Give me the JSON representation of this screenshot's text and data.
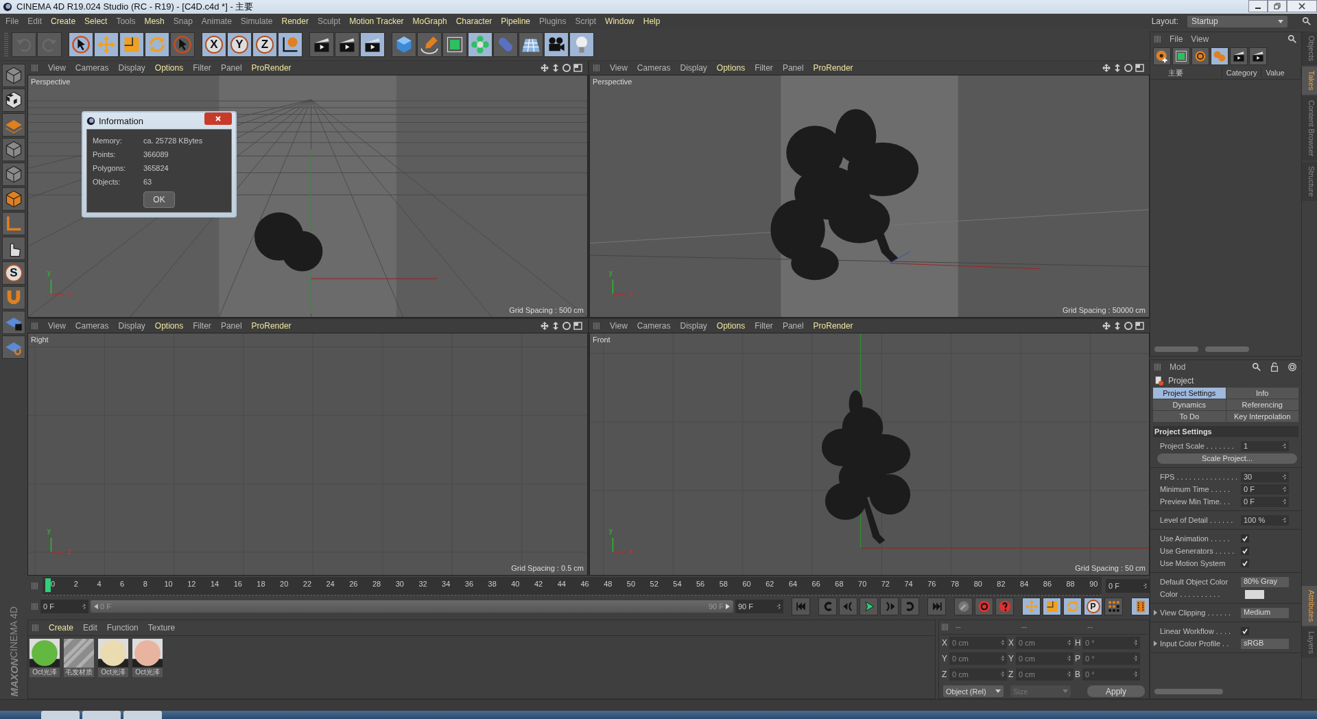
{
  "window": {
    "title": "CINEMA 4D R19.024 Studio (RC - R19) - [C4D.c4d *] - 主要"
  },
  "menu": [
    {
      "label": "File",
      "highlight": false
    },
    {
      "label": "Edit",
      "highlight": false
    },
    {
      "label": "Create",
      "highlight": true
    },
    {
      "label": "Select",
      "highlight": true
    },
    {
      "label": "Tools",
      "highlight": false
    },
    {
      "label": "Mesh",
      "highlight": true
    },
    {
      "label": "Snap",
      "highlight": false
    },
    {
      "label": "Animate",
      "highlight": false
    },
    {
      "label": "Simulate",
      "highlight": false
    },
    {
      "label": "Render",
      "highlight": true
    },
    {
      "label": "Sculpt",
      "highlight": false
    },
    {
      "label": "Motion Tracker",
      "highlight": true
    },
    {
      "label": "MoGraph",
      "highlight": true
    },
    {
      "label": "Character",
      "highlight": true
    },
    {
      "label": "Pipeline",
      "highlight": true
    },
    {
      "label": "Plugins",
      "highlight": false
    },
    {
      "label": "Script",
      "highlight": false
    },
    {
      "label": "Window",
      "highlight": true
    },
    {
      "label": "Help",
      "highlight": true
    }
  ],
  "layout": {
    "label": "Layout:",
    "value": "Startup"
  },
  "toolbar": [
    [
      {
        "kind": "undo",
        "active": false
      },
      {
        "kind": "redo",
        "active": false
      }
    ],
    [
      {
        "kind": "cursor",
        "active": true
      },
      {
        "kind": "move",
        "active": true
      },
      {
        "kind": "scale",
        "active": true
      },
      {
        "kind": "rotate",
        "active": true
      },
      {
        "kind": "cursor",
        "active": false
      }
    ],
    [
      {
        "kind": "letter",
        "label": "X",
        "active": true
      },
      {
        "kind": "letter",
        "label": "Y",
        "active": true
      },
      {
        "kind": "letter",
        "label": "Z",
        "active": true
      },
      {
        "kind": "world",
        "active": true
      }
    ],
    [
      {
        "kind": "clapper",
        "active": false
      },
      {
        "kind": "clapper",
        "active": false
      },
      {
        "kind": "clapper",
        "active": true
      }
    ],
    [
      {
        "kind": "cube",
        "active": false
      },
      {
        "kind": "pen",
        "active": false
      },
      {
        "kind": "cage",
        "active": false
      },
      {
        "kind": "flower",
        "active": true
      },
      {
        "kind": "capsule",
        "active": false
      },
      {
        "kind": "floor",
        "active": false
      },
      {
        "kind": "camera",
        "active": true
      },
      {
        "kind": "light",
        "active": true
      }
    ]
  ],
  "left_tools": [
    {
      "kind": "model",
      "active": false
    },
    {
      "kind": "checker",
      "active": false
    },
    {
      "kind": "plane",
      "active": false
    },
    {
      "kind": "model",
      "active": false
    },
    {
      "kind": "model",
      "active": false
    },
    {
      "kind": "face",
      "active": false
    },
    {
      "kind": "axis",
      "active": false
    },
    {
      "kind": "hand",
      "active": false
    },
    {
      "kind": "letter",
      "label": "S",
      "active": false
    },
    {
      "kind": "magnet",
      "active": false
    },
    {
      "kind": "lockgrid",
      "active": false
    },
    {
      "kind": "grid",
      "active": false
    }
  ],
  "viewports": [
    {
      "kind": "perspective-near",
      "name": "Perspective",
      "grid_spacing": "Grid Spacing : 500 cm",
      "axis_labels": [
        "y",
        "x"
      ],
      "menu": [
        {
          "label": "View",
          "highlight": false
        },
        {
          "label": "Cameras",
          "highlight": false
        },
        {
          "label": "Display",
          "highlight": false
        },
        {
          "label": "Options",
          "highlight": true
        },
        {
          "label": "Filter",
          "highlight": false
        },
        {
          "label": "Panel",
          "highlight": false
        },
        {
          "label": "ProRender",
          "highlight": true
        }
      ]
    },
    {
      "kind": "perspective-far",
      "name": "Perspective",
      "grid_spacing": "Grid Spacing : 50000 cm",
      "axis_labels": [
        "y",
        "x"
      ],
      "menu": [
        {
          "label": "View",
          "highlight": false
        },
        {
          "label": "Cameras",
          "highlight": false
        },
        {
          "label": "Display",
          "highlight": false
        },
        {
          "label": "Options",
          "highlight": true
        },
        {
          "label": "Filter",
          "highlight": false
        },
        {
          "label": "Panel",
          "highlight": false
        },
        {
          "label": "ProRender",
          "highlight": true
        }
      ]
    },
    {
      "kind": "side",
      "name": "Right",
      "grid_spacing": "Grid Spacing : 0.5 cm",
      "axis_labels": [
        "y",
        "z"
      ],
      "menu": [
        {
          "label": "View",
          "highlight": false
        },
        {
          "label": "Cameras",
          "highlight": false
        },
        {
          "label": "Display",
          "highlight": false
        },
        {
          "label": "Options",
          "highlight": true
        },
        {
          "label": "Filter",
          "highlight": false
        },
        {
          "label": "Panel",
          "highlight": false
        },
        {
          "label": "ProRender",
          "highlight": true
        }
      ]
    },
    {
      "kind": "front",
      "name": "Front",
      "grid_spacing": "Grid Spacing : 50 cm",
      "axis_labels": [
        "y",
        "x"
      ],
      "menu": [
        {
          "label": "View",
          "highlight": false
        },
        {
          "label": "Cameras",
          "highlight": false
        },
        {
          "label": "Display",
          "highlight": false
        },
        {
          "label": "Options",
          "highlight": true
        },
        {
          "label": "Filter",
          "highlight": false
        },
        {
          "label": "Panel",
          "highlight": false
        },
        {
          "label": "ProRender",
          "highlight": true
        }
      ]
    }
  ],
  "dialog": {
    "title": "Information",
    "rows": [
      {
        "label": "Memory:",
        "value": "ca. 25728 KBytes"
      },
      {
        "label": "Points:",
        "value": "366089"
      },
      {
        "label": "Polygons:",
        "value": "365824"
      },
      {
        "label": "Objects:",
        "value": "63"
      }
    ],
    "button": "OK"
  },
  "timeline": {
    "ticks": [
      "0",
      "2",
      "4",
      "6",
      "8",
      "10",
      "12",
      "14",
      "16",
      "18",
      "20",
      "22",
      "24",
      "26",
      "28",
      "30",
      "32",
      "34",
      "36",
      "38",
      "40",
      "42",
      "44",
      "46",
      "48",
      "50",
      "52",
      "54",
      "56",
      "58",
      "60",
      "62",
      "64",
      "66",
      "68",
      "70",
      "72",
      "74",
      "76",
      "78",
      "80",
      "82",
      "84",
      "86",
      "88",
      "90"
    ],
    "level": 0,
    "current": "0 F"
  },
  "range": {
    "start": "0 F",
    "slider_start": "0 F",
    "slider_end": "90 F",
    "end": "90 F"
  },
  "playback": [
    [
      {
        "kind": "first",
        "active": false
      }
    ],
    [
      {
        "kind": "prevkey",
        "active": false
      },
      {
        "kind": "prevframe",
        "active": false
      },
      {
        "kind": "play",
        "active": false
      },
      {
        "kind": "nextframe",
        "active": false
      },
      {
        "kind": "nextkey",
        "active": false
      }
    ],
    [
      {
        "kind": "last",
        "active": false
      }
    ],
    [
      {
        "kind": "key",
        "active": false
      },
      {
        "kind": "record",
        "active": false
      },
      {
        "kind": "help",
        "active": false
      }
    ],
    [
      {
        "kind": "move",
        "active": true
      },
      {
        "kind": "scale",
        "active": true
      },
      {
        "kind": "rotate",
        "active": true
      },
      {
        "kind": "letter",
        "label": "P",
        "active": true
      },
      {
        "kind": "dots",
        "active": false
      }
    ],
    [
      {
        "kind": "film",
        "active": true
      }
    ]
  ],
  "materials": {
    "menu": [
      {
        "label": "Create",
        "highlight": true
      },
      {
        "label": "Edit",
        "highlight": false
      },
      {
        "label": "Function",
        "highlight": false
      },
      {
        "label": "Texture",
        "highlight": false
      }
    ],
    "items": [
      {
        "name": "Oct光泽",
        "kind": "sphere",
        "color": "#62b840"
      },
      {
        "name": "毛发材质",
        "kind": "striped",
        "color": "#8c8c8c"
      },
      {
        "name": "Oct光泽",
        "kind": "sphere",
        "color": "#eadcb0"
      },
      {
        "name": "Oct光泽",
        "kind": "sphere",
        "color": "#e8b4a0"
      }
    ]
  },
  "logo": {
    "brand": "MAXON",
    "product": "CINEMA 4D"
  },
  "coordinates": {
    "headers": [
      "--",
      "--",
      "--"
    ],
    "rows": [
      {
        "axis": "X",
        "position": "0 cm",
        "size_axis": "X",
        "size": "0 cm",
        "rot_axis": "H",
        "rotation": "0 °"
      },
      {
        "axis": "Y",
        "position": "0 cm",
        "size_axis": "Y",
        "size": "0 cm",
        "rot_axis": "P",
        "rotation": "0 °"
      },
      {
        "axis": "Z",
        "position": "0 cm",
        "size_axis": "Z",
        "size": "0 cm",
        "rot_axis": "B",
        "rotation": "0 °"
      }
    ],
    "mode": {
      "value": "Object (Rel)",
      "disabled": false
    },
    "size_mode": {
      "value": "Size",
      "disabled": true
    },
    "apply": "Apply"
  },
  "objects_panel": {
    "menu": [
      "File",
      "View"
    ],
    "tools": [
      {
        "kind": "reel",
        "active": false
      },
      {
        "kind": "cage",
        "active": false
      },
      {
        "kind": "rings",
        "active": false
      },
      {
        "kind": "blobs",
        "active": true
      },
      {
        "kind": "clapper",
        "active": false
      },
      {
        "kind": "clapper",
        "active": false
      }
    ],
    "columns": [
      "Category",
      "Value"
    ],
    "items": [
      {
        "label": "主要"
      }
    ]
  },
  "side_tabs_top": [
    {
      "label": "Objects",
      "selected": false
    },
    {
      "label": "Takes",
      "selected": true
    },
    {
      "label": "Content Browser",
      "selected": false
    },
    {
      "label": "Structure",
      "selected": false
    }
  ],
  "side_tabs_bottom": [
    {
      "label": "Attributes",
      "selected": true
    },
    {
      "label": "Layers",
      "selected": false
    }
  ],
  "attributes": {
    "mode": "Mod",
    "object": "Project",
    "tabs": [
      {
        "label": "Project Settings",
        "selected": true
      },
      {
        "label": "Info",
        "selected": false
      },
      {
        "label": "Dynamics",
        "selected": false
      },
      {
        "label": "Referencing",
        "selected": false
      },
      {
        "label": "To Do",
        "selected": false
      },
      {
        "label": "Key Interpolation",
        "selected": false
      }
    ],
    "section": "Project Settings",
    "groups": [
      [
        {
          "kind": "field",
          "label": "Project Scale . . . . . . .",
          "value": "1"
        },
        {
          "kind": "button",
          "label": "Scale Project..."
        }
      ],
      [
        {
          "kind": "field",
          "label": "FPS . . . . . . . . . . . . . . .",
          "value": "30"
        },
        {
          "kind": "field",
          "label": "Minimum Time . . . . .",
          "value": "0 F"
        },
        {
          "kind": "field",
          "label": "Preview Min Time. . .",
          "value": "0 F"
        }
      ],
      [
        {
          "kind": "field",
          "label": "Level of Detail . . . . . .",
          "value": "100 %"
        }
      ],
      [
        {
          "kind": "check",
          "label": "Use Animation . . . . .",
          "checked": true
        },
        {
          "kind": "check",
          "label": "Use Generators . . . . .",
          "checked": true
        },
        {
          "kind": "check",
          "label": "Use Motion System",
          "checked": true
        }
      ],
      [
        {
          "kind": "dropdown",
          "label": "Default Object Color",
          "value": "80% Gray"
        },
        {
          "kind": "color",
          "label": "Color . . . . . . . . . .",
          "color": "#d9d9d9"
        }
      ],
      [
        {
          "kind": "dropdown",
          "label": "View Clipping . . . . . .",
          "value": "Medium",
          "expandable": true
        }
      ],
      [
        {
          "kind": "check",
          "label": "Linear Workflow . . . .",
          "checked": true
        },
        {
          "kind": "dropdown",
          "label": "Input Color Profile . .",
          "value": "sRGB",
          "expandable": true
        }
      ]
    ]
  }
}
